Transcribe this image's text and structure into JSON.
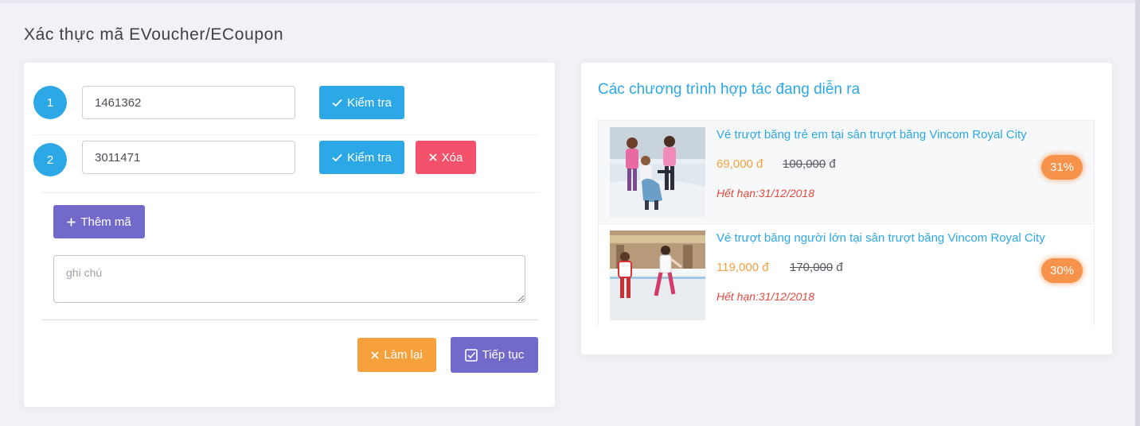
{
  "page": {
    "title": "Xác thực mã EVoucher/ECoupon"
  },
  "form": {
    "codes": [
      {
        "index": "1",
        "value": "1461362",
        "check_label": "Kiểm tra"
      },
      {
        "index": "2",
        "value": "3011471",
        "check_label": "Kiểm tra",
        "delete_label": "Xóa"
      }
    ],
    "add_label": "Thêm mã",
    "note_placeholder": "ghi chú",
    "reset_label": "Làm lại",
    "continue_label": "Tiếp tục"
  },
  "promotions": {
    "title": "Các chương trình hợp tác đang diễn ra",
    "items": [
      {
        "name": "Vé trượt băng trẻ em tại sân trượt băng Vincom Royal City",
        "price": "69,000 đ",
        "old_price": "100,000",
        "currency": "đ",
        "expiry": "Hết hạn:31/12/2018",
        "discount": "31%",
        "image": "kids-ice-skating-photo"
      },
      {
        "name": "Vé trượt băng người lớn tại sân trượt băng Vincom Royal City",
        "price": "119,000 đ",
        "old_price": "170,000",
        "currency": "đ",
        "expiry": "Hết hạn:31/12/2018",
        "discount": "30%",
        "image": "adult-ice-skating-photo"
      }
    ]
  },
  "colors": {
    "primary": "#2ca8e6",
    "danger": "#f4516c",
    "warning": "#f7a13c",
    "accent": "#716aca"
  }
}
